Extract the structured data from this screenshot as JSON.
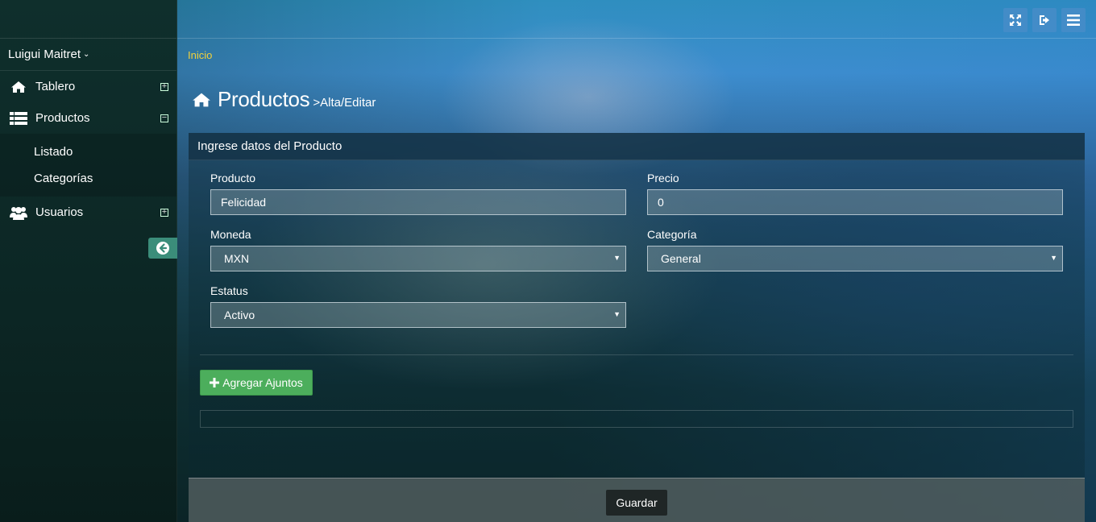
{
  "sidebar": {
    "user_name": "Luigui Maitret",
    "items": [
      {
        "label": "Tablero",
        "icon": "home-icon",
        "toggle": "⊞"
      },
      {
        "label": "Productos",
        "icon": "list-icon",
        "toggle": "⊟"
      },
      {
        "label": "Usuarios",
        "icon": "users-icon",
        "toggle": "⊞"
      }
    ],
    "sub_items": [
      {
        "label": "Listado"
      },
      {
        "label": "Categorías"
      }
    ]
  },
  "topbar": {
    "buttons": [
      "fullscreen-icon",
      "logout-icon",
      "menu-icon"
    ]
  },
  "breadcrumb": "Inicio",
  "page": {
    "title": "Productos",
    "subtitle": ">Alta/Editar"
  },
  "panel": {
    "header": "Ingrese datos del Producto",
    "fields": {
      "producto": {
        "label": "Producto",
        "value": "Felicidad"
      },
      "precio": {
        "label": "Precio",
        "value": "0"
      },
      "moneda": {
        "label": "Moneda",
        "value": "MXN"
      },
      "categoria": {
        "label": "Categoría",
        "value": "General"
      },
      "estatus": {
        "label": "Estatus",
        "value": "Activo"
      }
    },
    "add_attachments_label": "Agregar Ajuntos",
    "save_label": "Guardar"
  },
  "colors": {
    "breadcrumb": "#f3d23a",
    "add_button": "#4cae5c",
    "collapse_button": "#3b8d7a",
    "top_buttons": "#468cc8"
  }
}
